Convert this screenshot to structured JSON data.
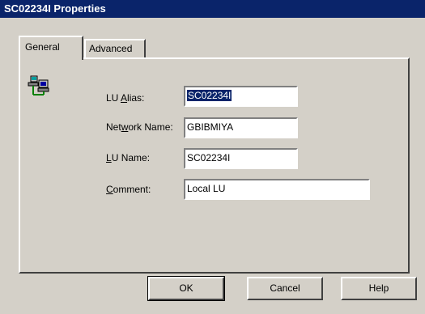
{
  "window": {
    "title": "SC02234I Properties"
  },
  "tabs": [
    {
      "label": "General",
      "active": true
    },
    {
      "label": "Advanced",
      "active": false
    }
  ],
  "icons": {
    "network": "network-computer-icon"
  },
  "form": {
    "lu_alias": {
      "label_pre": "LU ",
      "label_accel": "A",
      "label_post": "lias:",
      "value": "SC02234I",
      "selected": true
    },
    "network_name": {
      "label_pre": "Net",
      "label_accel": "w",
      "label_post": "ork Name:",
      "value": "GBIBMIYA"
    },
    "lu_name": {
      "label_pre": "",
      "label_accel": "L",
      "label_post": "U Name:",
      "value": "SC02234I"
    },
    "comment": {
      "label_pre": "",
      "label_accel": "C",
      "label_post": "omment:",
      "value": "Local LU"
    }
  },
  "buttons": {
    "ok": "OK",
    "cancel": "Cancel",
    "help": "Help"
  },
  "colors": {
    "title_bar": "#0a246a",
    "face": "#d4d0c8",
    "selection": "#0a246a"
  }
}
